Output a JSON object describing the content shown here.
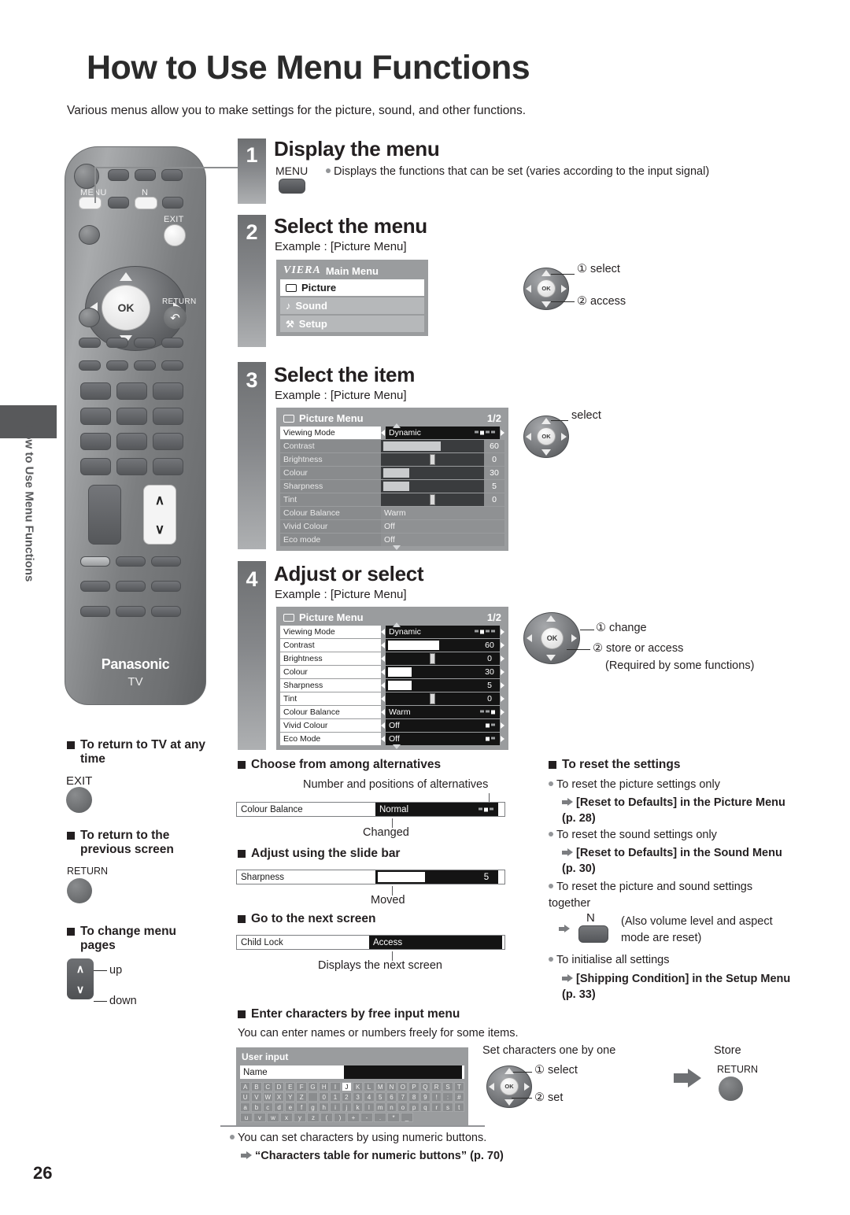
{
  "page": {
    "title": "How to Use Menu Functions",
    "intro": "Various menus allow you to make settings for the picture, sound, and other functions.",
    "side_tab_text": "How to Use Menu Functions",
    "page_number": "26"
  },
  "remote": {
    "menu_label": "MENU",
    "n_label": "N",
    "exit_label": "EXIT",
    "ok_label": "OK",
    "return_label": "RETURN",
    "brand": "Panasonic",
    "brand_sub": "TV",
    "up_glyph": "∧",
    "down_glyph": "∨"
  },
  "steps": [
    {
      "number": "1",
      "heading": "Display the menu",
      "button_label": "MENU",
      "note": "Displays the functions that can be set (varies according to the input signal)"
    },
    {
      "number": "2",
      "heading": "Select the menu",
      "example": "Example : [Picture Menu]",
      "annotations": [
        "① select",
        "② access"
      ]
    },
    {
      "number": "3",
      "heading": "Select the item",
      "example": "Example : [Picture Menu]",
      "annotations": [
        "select"
      ]
    },
    {
      "number": "4",
      "heading": "Adjust or select",
      "example": "Example : [Picture Menu]",
      "annotations": [
        "① change",
        "② store or access",
        "(Required by some functions)"
      ]
    }
  ],
  "main_menu": {
    "logo": "VIERA",
    "title": "Main Menu",
    "items": [
      {
        "label": "Picture",
        "icon": "picture-icon",
        "selected": true
      },
      {
        "label": "Sound",
        "icon": "note-icon",
        "selected": false
      },
      {
        "label": "Setup",
        "icon": "wrench-icon",
        "selected": false
      }
    ]
  },
  "picture_menu_3": {
    "title": "Picture Menu",
    "page_indicator": "1/2",
    "rows": [
      {
        "label": "Viewing Mode",
        "value": "Dynamic",
        "type": "options",
        "options_total": 4,
        "options_index": 1
      },
      {
        "label": "Contrast",
        "value": "60",
        "type": "slider",
        "percent": 60,
        "style": "fill"
      },
      {
        "label": "Brightness",
        "value": "0",
        "type": "slider",
        "percent": 50,
        "style": "knob"
      },
      {
        "label": "Colour",
        "value": "30",
        "type": "slider",
        "percent": 30,
        "style": "fill"
      },
      {
        "label": "Sharpness",
        "value": "5",
        "type": "slider",
        "percent": 30,
        "style": "fill"
      },
      {
        "label": "Tint",
        "value": "0",
        "type": "slider",
        "percent": 50,
        "style": "knob"
      },
      {
        "label": "Colour Balance",
        "value": "Warm",
        "type": "text"
      },
      {
        "label": "Vivid Colour",
        "value": "Off",
        "type": "text"
      },
      {
        "label": "Eco mode",
        "value": "Off",
        "type": "text"
      }
    ]
  },
  "picture_menu_4": {
    "title": "Picture Menu",
    "page_indicator": "1/2",
    "rows": [
      {
        "label": "Viewing Mode",
        "value": "Dynamic",
        "type": "options",
        "options_total": 4,
        "options_index": 1
      },
      {
        "label": "Contrast",
        "value": "60",
        "type": "slider",
        "percent": 60,
        "style": "fill"
      },
      {
        "label": "Brightness",
        "value": "0",
        "type": "slider",
        "percent": 50,
        "style": "knob"
      },
      {
        "label": "Colour",
        "value": "30",
        "type": "slider",
        "percent": 30,
        "style": "fill"
      },
      {
        "label": "Sharpness",
        "value": "5",
        "type": "slider",
        "percent": 30,
        "style": "fill"
      },
      {
        "label": "Tint",
        "value": "0",
        "type": "slider",
        "percent": 50,
        "style": "knob"
      },
      {
        "label": "Colour Balance",
        "value": "Warm",
        "type": "options",
        "options_total": 3,
        "options_index": 2
      },
      {
        "label": "Vivid Colour",
        "value": "Off",
        "type": "options",
        "options_total": 2,
        "options_index": 0
      },
      {
        "label": "Eco Mode",
        "value": "Off",
        "type": "options",
        "options_total": 2,
        "options_index": 0
      }
    ]
  },
  "left_tips": [
    {
      "heading": "To return to TV at any time",
      "button": "EXIT"
    },
    {
      "heading": "To return to the previous screen",
      "button": "RETURN"
    },
    {
      "heading": "To change menu pages",
      "up_label": "up",
      "down_label": "down"
    }
  ],
  "mid_sections": {
    "alternatives": {
      "heading": "Choose from among alternatives",
      "caption_top": "Number and positions of alternatives",
      "row": {
        "label": "Colour Balance",
        "value": "Normal",
        "options_total": 3,
        "options_index": 1
      },
      "caption_bottom": "Changed"
    },
    "slide_bar": {
      "heading": "Adjust using the slide bar",
      "row": {
        "label": "Sharpness",
        "value": "5",
        "percent": 48
      },
      "caption_bottom": "Moved"
    },
    "next_screen": {
      "heading": "Go to the next screen",
      "row": {
        "label": "Child Lock",
        "value": "Access"
      },
      "caption_bottom": "Displays the next screen"
    }
  },
  "reset_section": {
    "heading": "To reset the settings",
    "items": [
      {
        "text": "To reset the picture settings only",
        "ref": "[Reset to Defaults] in the Picture Menu (p. 28)"
      },
      {
        "text": "To reset the sound settings only",
        "ref": "[Reset to Defaults] in the Sound Menu (p. 30)"
      },
      {
        "text": "To reset the picture and sound settings together",
        "ref_button": "N",
        "ref_note": "(Also volume level and aspect mode are reset)"
      },
      {
        "text": "To initialise all settings",
        "ref": "[Shipping Condition] in the Setup Menu (p. 33)"
      }
    ]
  },
  "free_input": {
    "heading": "Enter characters by free input menu",
    "subtitle": "You can enter names or numbers freely for some items.",
    "dialog": {
      "title": "User input",
      "field_label": "Name",
      "field_value": "",
      "keyboard": [
        [
          "A",
          "B",
          "C",
          "D",
          "E",
          "F",
          "G",
          "H",
          "I",
          "J",
          "K",
          "L",
          "M",
          "N",
          "O",
          "P",
          "Q",
          "R",
          "S",
          "T"
        ],
        [
          "U",
          "V",
          "W",
          "X",
          "Y",
          "Z",
          "",
          "0",
          "1",
          "2",
          "3",
          "4",
          "5",
          "6",
          "7",
          "8",
          "9",
          "!",
          ":",
          "#"
        ],
        [
          "a",
          "b",
          "c",
          "d",
          "e",
          "f",
          "g",
          "h",
          "i",
          "j",
          "k",
          "l",
          "m",
          "n",
          "o",
          "p",
          "q",
          "r",
          "s",
          "t"
        ],
        [
          "u",
          "v",
          "w",
          "x",
          "y",
          "z",
          "(",
          ")",
          "+",
          "-",
          ".",
          "*",
          "_"
        ]
      ],
      "selected_key": "J"
    },
    "set_caption": "Set characters one by one",
    "set_annotations": [
      "① select",
      "② set"
    ],
    "store_caption": "Store",
    "store_button": "RETURN",
    "note": "You can set characters by using numeric buttons.",
    "note_ref": "“Characters table for numeric buttons” (p. 70)"
  }
}
